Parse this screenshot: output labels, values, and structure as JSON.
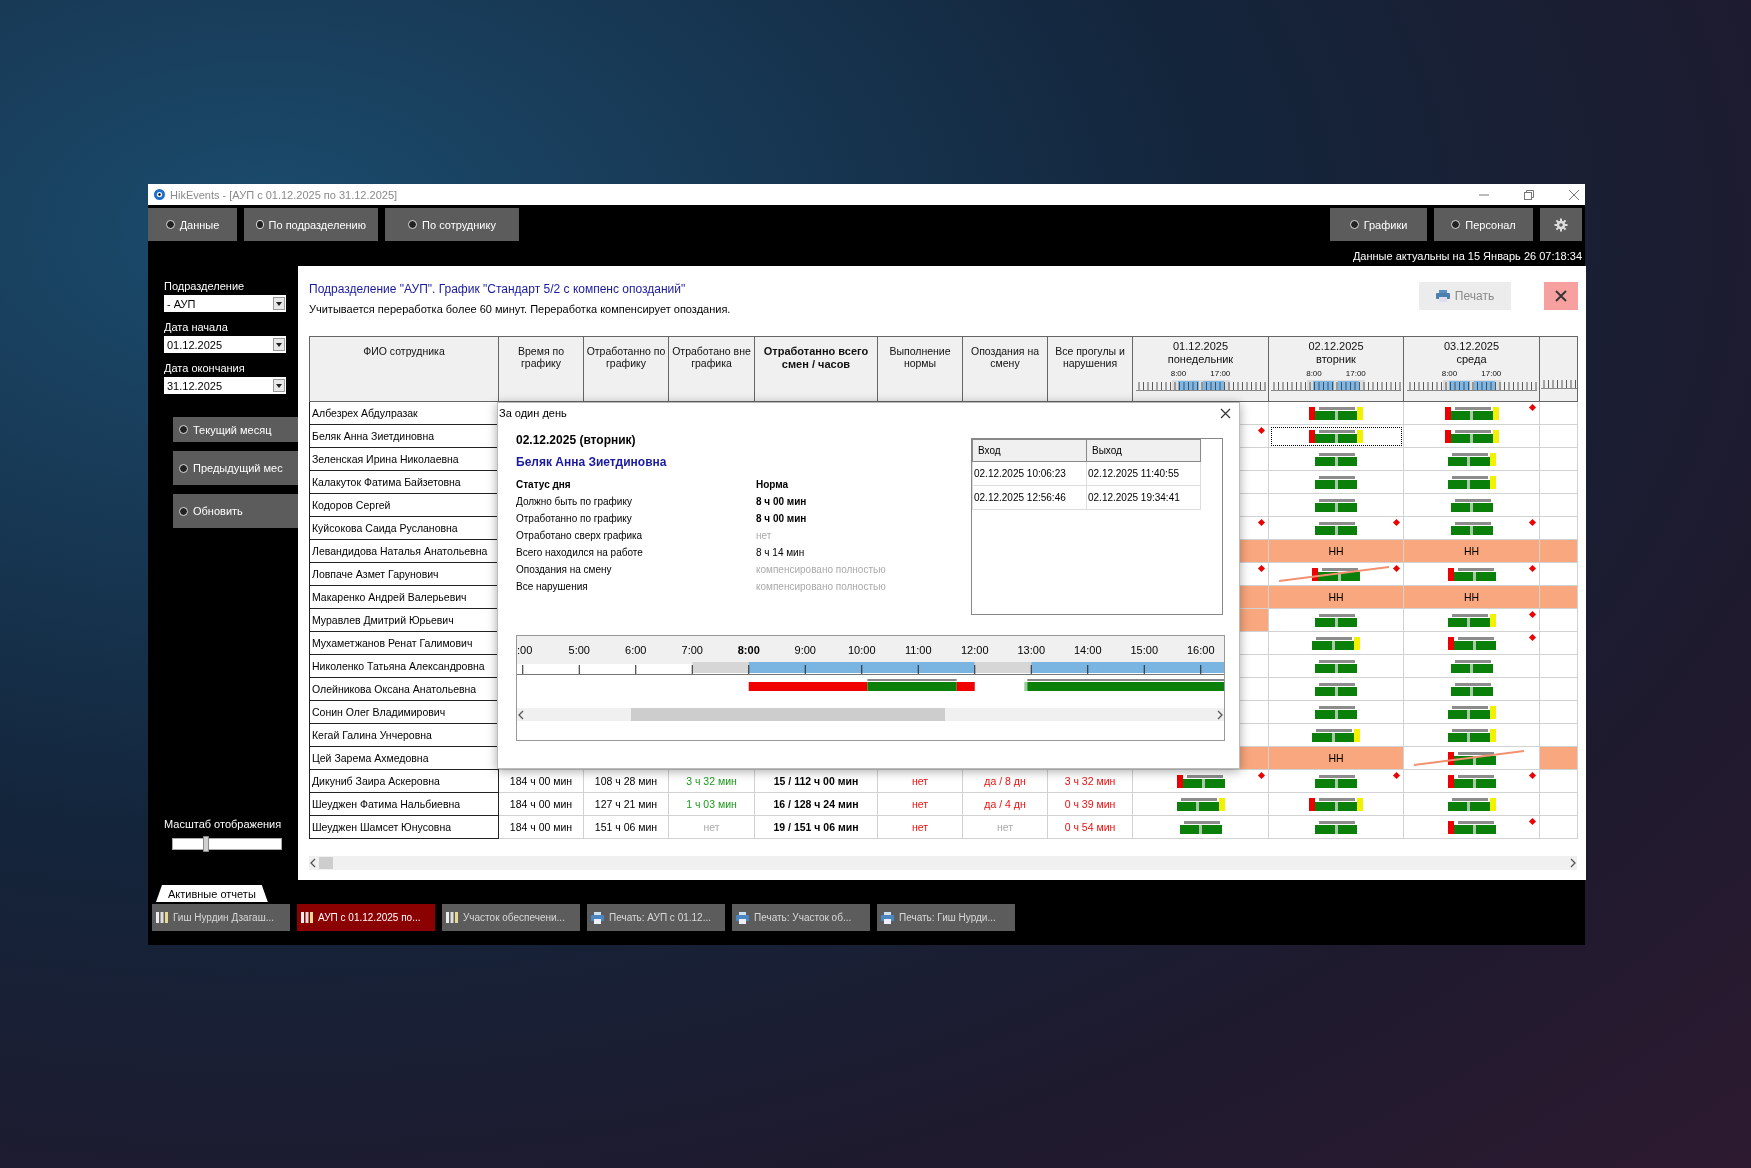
{
  "window": {
    "title": "HikEvents - [АУП с 01.12.2025 по 31.12.2025]"
  },
  "toolbar": {
    "left_tabs": [
      {
        "label": "Данные",
        "selected": false
      },
      {
        "label": "По подразделению",
        "selected": false
      },
      {
        "label": "По сотруднику",
        "selected": false
      }
    ],
    "right_tabs": [
      {
        "label": "Графики",
        "selected": false
      },
      {
        "label": "Персонал",
        "selected": false
      }
    ],
    "status": "Данные актуальны на 15 Январь 26 07:18:34"
  },
  "sidebar": {
    "fields": [
      {
        "label": "Подразделение",
        "value": "- АУП"
      },
      {
        "label": "Дата начала",
        "value": "01.12.2025"
      },
      {
        "label": "Дата окончания",
        "value": "31.12.2025"
      }
    ],
    "buttons": [
      {
        "label": "Текущий месяц",
        "selected": false
      },
      {
        "label": "Предыдущий мес",
        "selected": false
      },
      {
        "label": "Обновить",
        "selected": false
      }
    ],
    "scale": {
      "label": "Масштаб отображения",
      "level": 0.31
    }
  },
  "report": {
    "title": "Подразделение \"АУП\". График \"Стандарт 5/2 с компенс опозданий\"",
    "subtitle": "Учитывается переработка более 60 минут. Переработка компенсирует опоздания.",
    "print": {
      "label": "Печать",
      "disabled": true
    }
  },
  "table": {
    "columns": [
      {
        "label": "ФИО сотрудника",
        "emphasis": false
      },
      {
        "label": "Время по графику",
        "emphasis": false
      },
      {
        "label": "Отработанно по графику",
        "emphasis": false
      },
      {
        "label": "Отработано вне графика",
        "emphasis": false
      },
      {
        "label": "Отработанно всего смен / часов",
        "emphasis": true
      },
      {
        "label": "Выполнение нормы",
        "emphasis": false
      },
      {
        "label": "Опоздания на смену",
        "emphasis": false
      },
      {
        "label": "Все прогулы и нарушения",
        "emphasis": false
      }
    ],
    "days": [
      {
        "date": "01.12.2025",
        "weekday": "понедельник",
        "ticks": [
          "8:00",
          "17:00"
        ]
      },
      {
        "date": "02.12.2025",
        "weekday": "вторник",
        "ticks": [
          "8:00",
          "17:00"
        ]
      },
      {
        "date": "03.12.2025",
        "weekday": "среда",
        "ticks": [
          "8:00",
          "17:00"
        ]
      }
    ],
    "rows": [
      {
        "name": "Албезрех Абдулразак",
        "days": [
          {
            "kind": "blank",
            "flag": false,
            "selected": false
          },
          {
            "kind": "bars",
            "late": true,
            "early": true,
            "flag": false,
            "selected": false
          },
          {
            "kind": "bars",
            "late": true,
            "early": true,
            "flag": true,
            "selected": false
          },
          {
            "kind": "blank",
            "flag": false,
            "selected": false
          }
        ]
      },
      {
        "name": "Беляк Анна Зиетдиновна",
        "days": [
          {
            "kind": "blank",
            "flag": true,
            "selected": false
          },
          {
            "kind": "bars",
            "late": true,
            "early": true,
            "flag": false,
            "selected": true
          },
          {
            "kind": "bars",
            "late": true,
            "early": true,
            "flag": false,
            "selected": false
          },
          {
            "kind": "blank",
            "flag": false,
            "selected": false
          }
        ]
      },
      {
        "name": "Зеленская Ирина Николаевна",
        "days": [
          {
            "kind": "blank",
            "flag": false,
            "selected": false
          },
          {
            "kind": "bars",
            "late": false,
            "early": false,
            "flag": false,
            "selected": false
          },
          {
            "kind": "bars",
            "late": false,
            "early": true,
            "flag": false,
            "selected": false
          },
          {
            "kind": "blank",
            "flag": false,
            "selected": false
          }
        ]
      },
      {
        "name": "Калакуток Фатима Байзетовна",
        "days": [
          {
            "kind": "blank",
            "flag": false,
            "selected": false
          },
          {
            "kind": "bars",
            "late": false,
            "early": false,
            "flag": false,
            "selected": false
          },
          {
            "kind": "bars",
            "late": false,
            "early": true,
            "flag": false,
            "selected": false
          },
          {
            "kind": "blank",
            "flag": false,
            "selected": false
          }
        ]
      },
      {
        "name": "Кодоров Сергей",
        "days": [
          {
            "kind": "blank",
            "flag": false,
            "selected": false
          },
          {
            "kind": "bars",
            "late": false,
            "early": false,
            "flag": false,
            "selected": false
          },
          {
            "kind": "bars",
            "late": false,
            "early": false,
            "flag": false,
            "selected": false
          },
          {
            "kind": "blank",
            "flag": false,
            "selected": false
          }
        ]
      },
      {
        "name": "Куйсокова Саида Руслановна",
        "days": [
          {
            "kind": "blank",
            "flag": true,
            "selected": false
          },
          {
            "kind": "bars",
            "late": false,
            "early": false,
            "flag": true,
            "selected": false
          },
          {
            "kind": "bars",
            "late": false,
            "early": false,
            "flag": true,
            "selected": false
          },
          {
            "kind": "blank",
            "flag": false,
            "selected": false
          }
        ]
      },
      {
        "name": "Левандидова Наталья Анатольевна",
        "days": [
          {
            "kind": "absent",
            "flag": false,
            "selected": false
          },
          {
            "kind": "nn",
            "label": "НН",
            "flag": false,
            "selected": false
          },
          {
            "kind": "nn",
            "label": "НН",
            "flag": false,
            "selected": false
          },
          {
            "kind": "absent",
            "flag": false,
            "selected": false
          }
        ]
      },
      {
        "name": "Ловпаче Азмет Гарунович",
        "days": [
          {
            "kind": "blank",
            "flag": true,
            "selected": false
          },
          {
            "kind": "strike",
            "late": true,
            "early": false,
            "flag": true,
            "selected": false
          },
          {
            "kind": "bars",
            "late": true,
            "early": false,
            "flag": true,
            "selected": false
          },
          {
            "kind": "blank",
            "flag": false,
            "selected": false
          }
        ]
      },
      {
        "name": "Макаренко Андрей Валерьевич",
        "days": [
          {
            "kind": "absent",
            "flag": false,
            "selected": false
          },
          {
            "kind": "nn",
            "label": "НН",
            "flag": false,
            "selected": false
          },
          {
            "kind": "nn",
            "label": "НН",
            "flag": false,
            "selected": false
          },
          {
            "kind": "absent",
            "flag": false,
            "selected": false
          }
        ]
      },
      {
        "name": "Муравлев Дмитрий Юрьевич",
        "days": [
          {
            "kind": "absent",
            "flag": false,
            "selected": false
          },
          {
            "kind": "bars",
            "late": false,
            "early": false,
            "flag": false,
            "selected": false
          },
          {
            "kind": "bars",
            "late": false,
            "early": true,
            "flag": true,
            "selected": false
          },
          {
            "kind": "blank",
            "flag": false,
            "selected": false
          }
        ]
      },
      {
        "name": "Мухаметжанов Ренат Галимович",
        "days": [
          {
            "kind": "blank",
            "flag": false,
            "selected": false
          },
          {
            "kind": "bars",
            "late": false,
            "early": true,
            "flag": false,
            "selected": false
          },
          {
            "kind": "bars",
            "late": true,
            "early": false,
            "flag": true,
            "selected": false
          },
          {
            "kind": "blank",
            "flag": false,
            "selected": false
          }
        ]
      },
      {
        "name": "Николенко Татьяна Александровна",
        "days": [
          {
            "kind": "blank",
            "flag": false,
            "selected": false
          },
          {
            "kind": "bars",
            "late": false,
            "early": false,
            "flag": false,
            "selected": false
          },
          {
            "kind": "bars",
            "late": false,
            "early": false,
            "flag": false,
            "selected": false
          },
          {
            "kind": "blank",
            "flag": false,
            "selected": false
          }
        ]
      },
      {
        "name": "Олейникова Оксана Анатольевна",
        "days": [
          {
            "kind": "blank",
            "flag": false,
            "selected": false
          },
          {
            "kind": "bars",
            "late": false,
            "early": false,
            "flag": false,
            "selected": false
          },
          {
            "kind": "bars",
            "late": false,
            "early": false,
            "flag": false,
            "selected": false
          },
          {
            "kind": "blank",
            "flag": false,
            "selected": false
          }
        ]
      },
      {
        "name": "Сонин Олег Владимирович",
        "days": [
          {
            "kind": "blank",
            "flag": false,
            "selected": false
          },
          {
            "kind": "bars",
            "late": false,
            "early": false,
            "flag": false,
            "selected": false
          },
          {
            "kind": "bars",
            "late": false,
            "early": true,
            "flag": false,
            "selected": false
          },
          {
            "kind": "blank",
            "flag": false,
            "selected": false
          }
        ]
      },
      {
        "name": "Кегай Галина Унчеровна",
        "days": [
          {
            "kind": "blank",
            "flag": false,
            "selected": false
          },
          {
            "kind": "bars",
            "late": false,
            "early": true,
            "flag": false,
            "selected": false
          },
          {
            "kind": "bars",
            "late": false,
            "early": true,
            "flag": false,
            "selected": false
          },
          {
            "kind": "blank",
            "flag": false,
            "selected": false
          }
        ]
      },
      {
        "name": "Цей Зарема Ахмедовна",
        "days": [
          {
            "kind": "absent",
            "flag": false,
            "selected": false
          },
          {
            "kind": "nn",
            "label": "НН",
            "flag": false,
            "selected": false
          },
          {
            "kind": "strike",
            "late": true,
            "early": false,
            "flag": false,
            "selected": false
          },
          {
            "kind": "absent",
            "flag": false,
            "selected": false
          }
        ]
      },
      {
        "name": "Дикуниб Заира Аскеровна",
        "values": [
          {
            "text": "184 ч 00 мин",
            "kind": "plain"
          },
          {
            "text": "108 ч 28 мин",
            "kind": "plain"
          },
          {
            "text": "3 ч 32 мин",
            "kind": "green"
          },
          {
            "text": "15 / 112 ч 00 мин",
            "kind": "bold"
          },
          {
            "text": "нет",
            "kind": "red"
          },
          {
            "text": "да / 8 дн",
            "kind": "red"
          },
          {
            "text": "3 ч 32 мин",
            "kind": "red"
          }
        ],
        "days": [
          {
            "kind": "bars",
            "late": true,
            "early": false,
            "flag": true,
            "selected": false
          },
          {
            "kind": "bars",
            "late": false,
            "early": false,
            "flag": true,
            "selected": false
          },
          {
            "kind": "bars",
            "late": true,
            "early": false,
            "flag": true,
            "selected": false
          },
          {
            "kind": "blank",
            "flag": false,
            "selected": false
          }
        ]
      },
      {
        "name": "Шеуджен Фатима Нальбиевна",
        "values": [
          {
            "text": "184 ч 00 мин",
            "kind": "plain"
          },
          {
            "text": "127 ч 21 мин",
            "kind": "plain"
          },
          {
            "text": "1 ч 03 мин",
            "kind": "green"
          },
          {
            "text": "16 / 128 ч 24 мин",
            "kind": "bold"
          },
          {
            "text": "нет",
            "kind": "red"
          },
          {
            "text": "да / 4 дн",
            "kind": "red"
          },
          {
            "text": "0 ч 39 мин",
            "kind": "red"
          }
        ],
        "days": [
          {
            "kind": "bars",
            "late": false,
            "early": true,
            "flag": false,
            "selected": false
          },
          {
            "kind": "bars",
            "late": true,
            "early": true,
            "flag": false,
            "selected": false
          },
          {
            "kind": "bars",
            "late": false,
            "early": true,
            "flag": false,
            "selected": false
          },
          {
            "kind": "blank",
            "flag": false,
            "selected": false
          }
        ]
      },
      {
        "name": "Шеуджен Шамсет Юнусовна",
        "values": [
          {
            "text": "184 ч 00 мин",
            "kind": "plain"
          },
          {
            "text": "151 ч 06 мин",
            "kind": "plain"
          },
          {
            "text": "нет",
            "kind": "muted"
          },
          {
            "text": "19 / 151 ч 06 мин",
            "kind": "bold"
          },
          {
            "text": "нет",
            "kind": "red"
          },
          {
            "text": "нет",
            "kind": "muted"
          },
          {
            "text": "0 ч 54 мин",
            "kind": "red"
          }
        ],
        "days": [
          {
            "kind": "bars",
            "late": false,
            "early": false,
            "flag": false,
            "selected": false
          },
          {
            "kind": "bars",
            "late": false,
            "early": false,
            "flag": false,
            "selected": false
          },
          {
            "kind": "bars",
            "late": true,
            "early": false,
            "flag": true,
            "selected": false
          },
          {
            "kind": "blank",
            "flag": false,
            "selected": false
          }
        ]
      }
    ]
  },
  "dialog": {
    "title": "За один день",
    "date": "02.12.2025 (вторник)",
    "employee": "Беляк Анна Зиетдиновна",
    "details": [
      {
        "kind": "header",
        "label": "Статус дня",
        "value": "Норма"
      },
      {
        "kind": "bold",
        "label": "Должно быть по графику",
        "value": "8 ч 00 мин"
      },
      {
        "kind": "bold",
        "label": "Отработанно по графику",
        "value": "8 ч 00 мин"
      },
      {
        "kind": "muted",
        "label": "Отработано сверх графика",
        "value": "нет"
      },
      {
        "kind": "plain",
        "label": "Всего находился на работе",
        "value": "8 ч 14 мин"
      },
      {
        "kind": "muted",
        "label": "Опоздания на смену",
        "value": "компенсировано полностью"
      },
      {
        "kind": "muted",
        "label": "Все нарушения",
        "value": "компенсировано полностью"
      }
    ],
    "entries": {
      "columns": [
        "Вход",
        "Выход"
      ],
      "rows": [
        [
          "02.12.2025 10:06:23",
          "02.12.2025 11:40:55"
        ],
        [
          "02.12.2025 12:56:46",
          "02.12.2025 19:34:41"
        ]
      ]
    },
    "hours": [
      {
        "text": ":00",
        "bold": false
      },
      {
        "text": "5:00",
        "bold": false
      },
      {
        "text": "6:00",
        "bold": false
      },
      {
        "text": "7:00",
        "bold": false
      },
      {
        "text": "8:00",
        "bold": true
      },
      {
        "text": "9:00",
        "bold": false
      },
      {
        "text": "10:00",
        "bold": false
      },
      {
        "text": "11:00",
        "bold": false
      },
      {
        "text": "12:00",
        "bold": false
      },
      {
        "text": "13:00",
        "bold": false
      },
      {
        "text": "14:00",
        "bold": false
      },
      {
        "text": "15:00",
        "bold": false
      },
      {
        "text": "16:00",
        "bold": false
      }
    ]
  },
  "taskbar": {
    "tab": "Активные отчеты",
    "items": [
      {
        "kind": "report",
        "label": "Гиш Нурдин Дзагаш...",
        "selected": false
      },
      {
        "kind": "report",
        "label": "АУП с 01.12.2025 по...",
        "selected": true
      },
      {
        "kind": "report",
        "label": "Участок обеспечени...",
        "selected": false
      },
      {
        "kind": "print",
        "label": "Печать: АУП с 01.12...",
        "selected": false
      },
      {
        "kind": "print",
        "label": "Печать: Участок об...",
        "selected": false
      },
      {
        "kind": "print",
        "label": "Печать: Гиш Нурди...",
        "selected": false
      }
    ]
  }
}
